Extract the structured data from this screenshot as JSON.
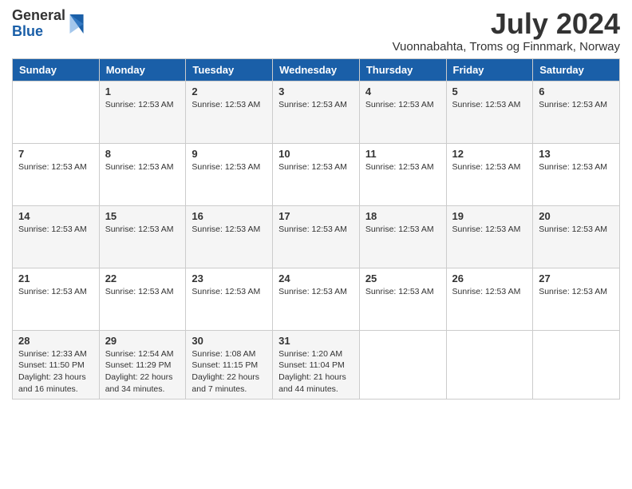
{
  "logo": {
    "general": "General",
    "blue": "Blue"
  },
  "header": {
    "month": "July 2024",
    "location": "Vuonnabahta, Troms og Finnmark, Norway"
  },
  "weekdays": [
    "Sunday",
    "Monday",
    "Tuesday",
    "Wednesday",
    "Thursday",
    "Friday",
    "Saturday"
  ],
  "weeks": [
    [
      {
        "day": "",
        "info": ""
      },
      {
        "day": "1",
        "info": "Sunrise: 12:53 AM"
      },
      {
        "day": "2",
        "info": "Sunrise: 12:53 AM"
      },
      {
        "day": "3",
        "info": "Sunrise: 12:53 AM"
      },
      {
        "day": "4",
        "info": "Sunrise: 12:53 AM"
      },
      {
        "day": "5",
        "info": "Sunrise: 12:53 AM"
      },
      {
        "day": "6",
        "info": "Sunrise: 12:53 AM"
      }
    ],
    [
      {
        "day": "7",
        "info": "Sunrise: 12:53 AM"
      },
      {
        "day": "8",
        "info": "Sunrise: 12:53 AM"
      },
      {
        "day": "9",
        "info": "Sunrise: 12:53 AM"
      },
      {
        "day": "10",
        "info": "Sunrise: 12:53 AM"
      },
      {
        "day": "11",
        "info": "Sunrise: 12:53 AM"
      },
      {
        "day": "12",
        "info": "Sunrise: 12:53 AM"
      },
      {
        "day": "13",
        "info": "Sunrise: 12:53 AM"
      }
    ],
    [
      {
        "day": "14",
        "info": "Sunrise: 12:53 AM"
      },
      {
        "day": "15",
        "info": "Sunrise: 12:53 AM"
      },
      {
        "day": "16",
        "info": "Sunrise: 12:53 AM"
      },
      {
        "day": "17",
        "info": "Sunrise: 12:53 AM"
      },
      {
        "day": "18",
        "info": "Sunrise: 12:53 AM"
      },
      {
        "day": "19",
        "info": "Sunrise: 12:53 AM"
      },
      {
        "day": "20",
        "info": "Sunrise: 12:53 AM"
      }
    ],
    [
      {
        "day": "21",
        "info": "Sunrise: 12:53 AM"
      },
      {
        "day": "22",
        "info": "Sunrise: 12:53 AM"
      },
      {
        "day": "23",
        "info": "Sunrise: 12:53 AM"
      },
      {
        "day": "24",
        "info": "Sunrise: 12:53 AM"
      },
      {
        "day": "25",
        "info": "Sunrise: 12:53 AM"
      },
      {
        "day": "26",
        "info": "Sunrise: 12:53 AM"
      },
      {
        "day": "27",
        "info": "Sunrise: 12:53 AM"
      }
    ],
    [
      {
        "day": "28",
        "info": "Sunrise: 12:33 AM\nSunset: 11:50 PM\nDaylight: 23 hours and 16 minutes."
      },
      {
        "day": "29",
        "info": "Sunrise: 12:54 AM\nSunset: 11:29 PM\nDaylight: 22 hours and 34 minutes."
      },
      {
        "day": "30",
        "info": "Sunrise: 1:08 AM\nSunset: 11:15 PM\nDaylight: 22 hours and 7 minutes."
      },
      {
        "day": "31",
        "info": "Sunrise: 1:20 AM\nSunset: 11:04 PM\nDaylight: 21 hours and 44 minutes."
      },
      {
        "day": "",
        "info": ""
      },
      {
        "day": "",
        "info": ""
      },
      {
        "day": "",
        "info": ""
      }
    ]
  ]
}
